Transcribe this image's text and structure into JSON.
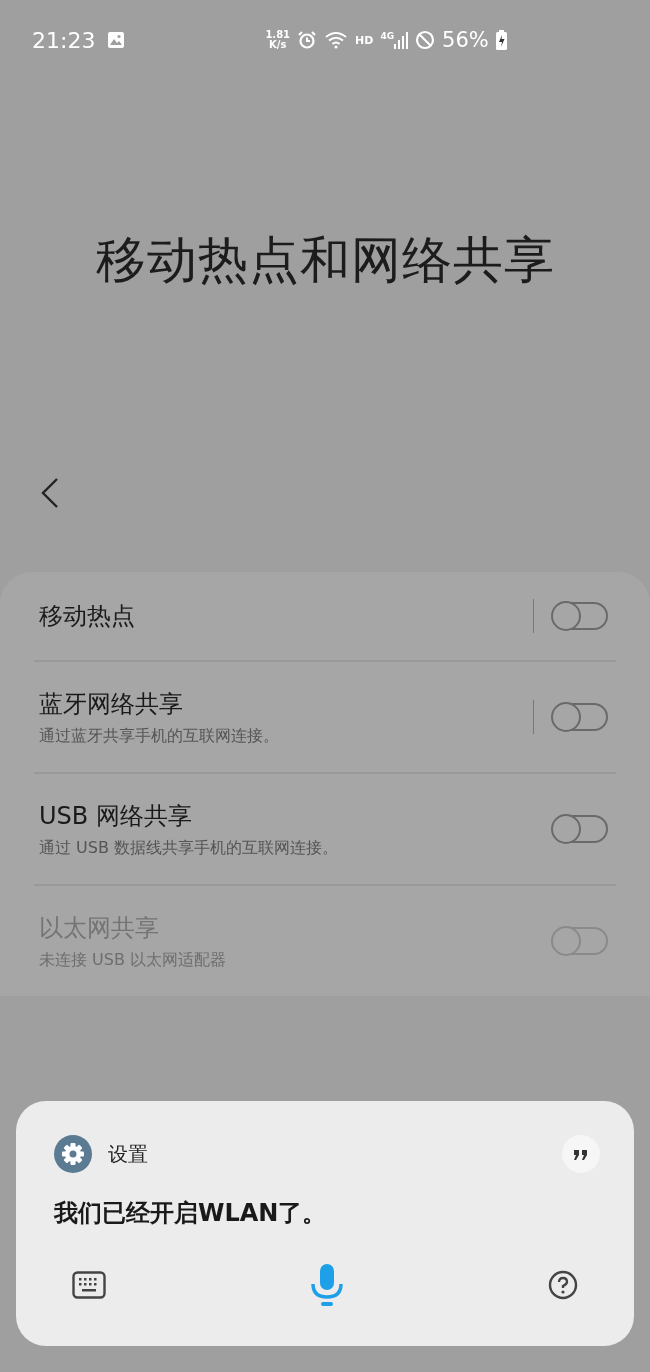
{
  "status_bar": {
    "time": "21:23",
    "net_speed": [
      "1.81",
      "K/s"
    ],
    "hd": "HD",
    "network": "4G",
    "battery": "56%"
  },
  "title": "移动热点和网络共享",
  "items": [
    {
      "title": "移动热点",
      "on": false,
      "disabled": false,
      "split": true
    },
    {
      "title": "蓝牙网络共享",
      "subtitle": "通过蓝牙共享手机的互联网连接。",
      "on": false,
      "disabled": false,
      "split": true
    },
    {
      "title": "USB 网络共享",
      "subtitle": "通过 USB 数据线共享手机的互联网连接。",
      "on": false,
      "disabled": false,
      "split": false
    },
    {
      "title": "以太网共享",
      "subtitle": "未连接 USB 以太网适配器",
      "on": false,
      "disabled": true,
      "split": false
    }
  ],
  "assistant": {
    "app": "设置",
    "message": "我们已经开启WLAN了。"
  }
}
